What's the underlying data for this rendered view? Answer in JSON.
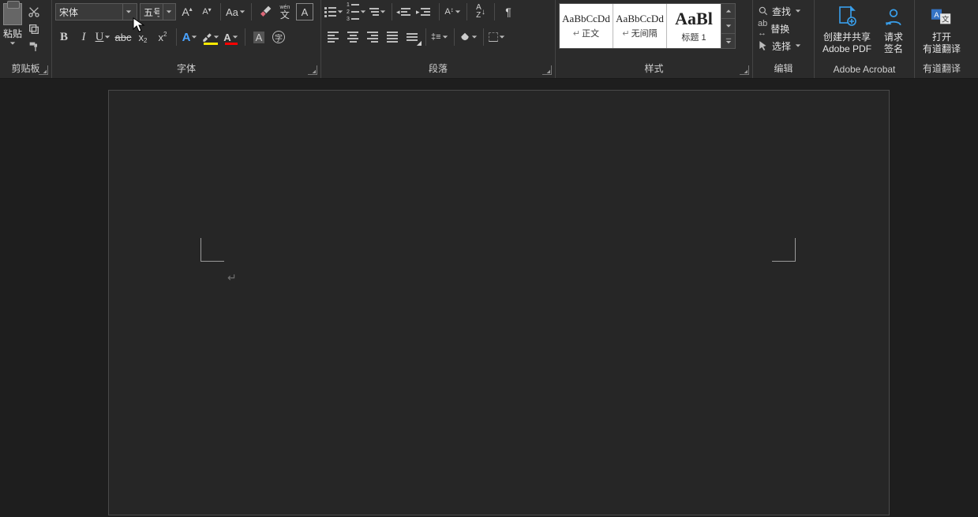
{
  "clipboard": {
    "paste": "粘贴",
    "group": "剪贴板"
  },
  "font": {
    "name": "宋体",
    "size": "五号",
    "group": "字体",
    "bold": "B",
    "italic": "I",
    "underline": "U",
    "strike": "abc",
    "sub": "x",
    "sup": "x",
    "growA": "A",
    "shrinkA": "A",
    "caseAa": "Aa",
    "wen_top": "wén",
    "wen_bot": "文",
    "charBorder": "A",
    "effectsA": "A",
    "fontColorA": "A",
    "circled": "字"
  },
  "paragraph": {
    "group": "段落"
  },
  "styles": {
    "group": "样式",
    "preview": "AaBbCcDd",
    "preview_big": "AaBl",
    "items": [
      {
        "name": "正文",
        "para": true
      },
      {
        "name": "无间隔",
        "para": true
      },
      {
        "name": "标题 1",
        "para": false
      }
    ]
  },
  "editing": {
    "find": "查找",
    "replace": "替换",
    "select": "选择",
    "group": "编辑"
  },
  "acrobat": {
    "create": "创建并共享\nAdobe PDF",
    "sign": "请求\n签名",
    "group": "Adobe Acrobat"
  },
  "youdao": {
    "open": "打开\n有道翻译",
    "group": "有道翻译"
  },
  "doc": {
    "pilcrow": "↵"
  }
}
